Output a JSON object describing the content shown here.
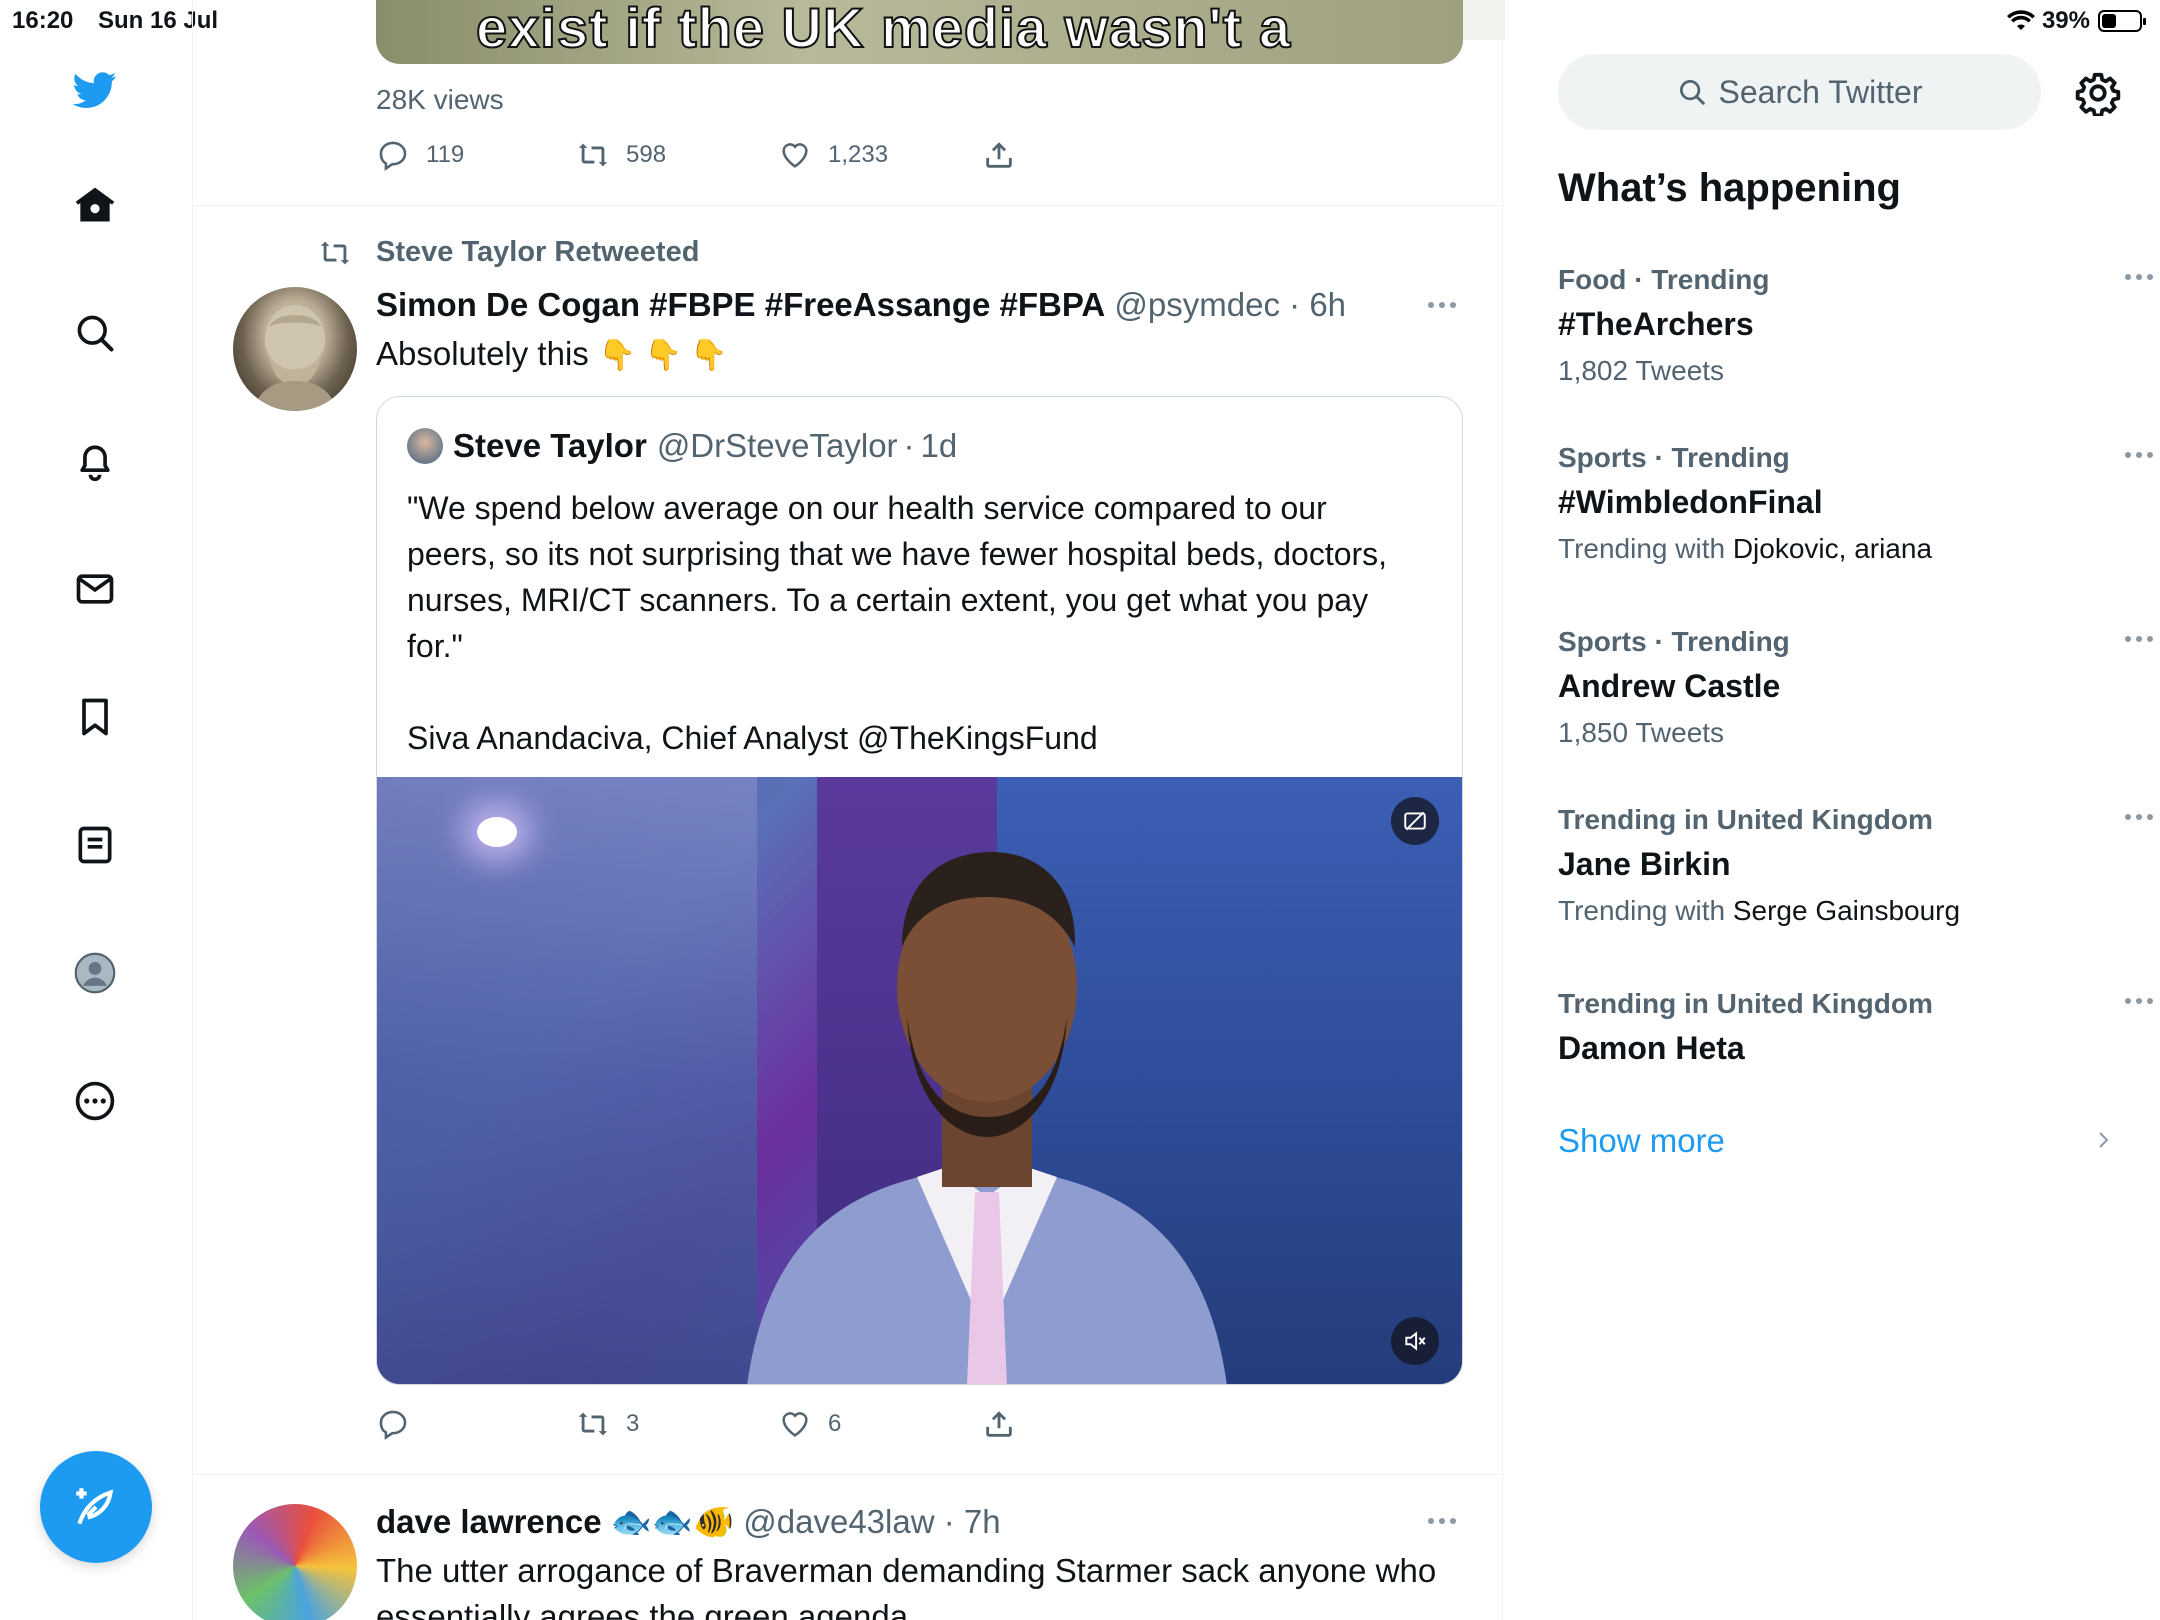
{
  "status": {
    "time": "16:20",
    "date": "Sun 16 Jul",
    "battery": "39%",
    "battery_level": 0.39
  },
  "nav": {
    "icons": [
      "twitter-logo-icon",
      "home-icon",
      "explore-icon",
      "notifications-icon",
      "messages-icon",
      "bookmarks-icon",
      "lists-icon",
      "profile-icon",
      "more-icon"
    ],
    "compose": "compose-tweet-icon"
  },
  "previous_tweet": {
    "media_text": "exist if the UK media wasn't a",
    "views": "28K views",
    "replies": "119",
    "retweets": "598",
    "likes": "1,233"
  },
  "tweet1": {
    "retweeted_by": "Steve Taylor Retweeted",
    "name": "Simon De Cogan #FBPE #FreeAssange #FBPA",
    "handle": "@psymdec",
    "time": "6h",
    "text": "Absolutely this",
    "emoji": "👇 👇 👇",
    "quote": {
      "name": "Steve Taylor",
      "handle": "@DrSteveTaylor",
      "time": "1d",
      "text_1": "\"We spend below average on our health service compared to our peers, so its not surprising that we have fewer hospital beds, doctors, nurses, MRI/CT scanners. To a certain extent, you get what you pay for.\"",
      "text_2": "Siva Anandaciva, Chief Analyst @TheKingsFund"
    },
    "replies": "",
    "retweets": "3",
    "likes": "6"
  },
  "tweet2": {
    "name": "dave lawrence",
    "name_emoji": "🐟🐟🐠",
    "handle": "@dave43law",
    "time": "7h",
    "text_line1": "The utter arrogance of Braverman demanding Starmer sack anyone who",
    "text_line2": "essentially agrees the green agenda..."
  },
  "sidebar": {
    "search_placeholder": "Search Twitter",
    "title": "What’s happening",
    "trends": [
      {
        "context": "Food · Trending",
        "topic": "#TheArchers",
        "sub_prefix": "",
        "sub_value": "",
        "count": "1,802 Tweets"
      },
      {
        "context": "Sports · Trending",
        "topic": "#WimbledonFinal",
        "sub_prefix": "Trending with ",
        "sub_value": "Djokovic, ariana",
        "count": ""
      },
      {
        "context": "Sports · Trending",
        "topic": "Andrew Castle",
        "sub_prefix": "",
        "sub_value": "",
        "count": "1,850 Tweets"
      },
      {
        "context": "Trending in United Kingdom",
        "topic": "Jane Birkin",
        "sub_prefix": "Trending with ",
        "sub_value": "Serge Gainsbourg",
        "count": ""
      },
      {
        "context": "Trending in United Kingdom",
        "topic": "Damon Heta",
        "sub_prefix": "",
        "sub_value": "",
        "count": ""
      }
    ],
    "show_more": "Show more"
  },
  "colors": {
    "accent": "#1d9bf0",
    "text_primary": "#0f1419",
    "text_secondary": "#536471"
  }
}
